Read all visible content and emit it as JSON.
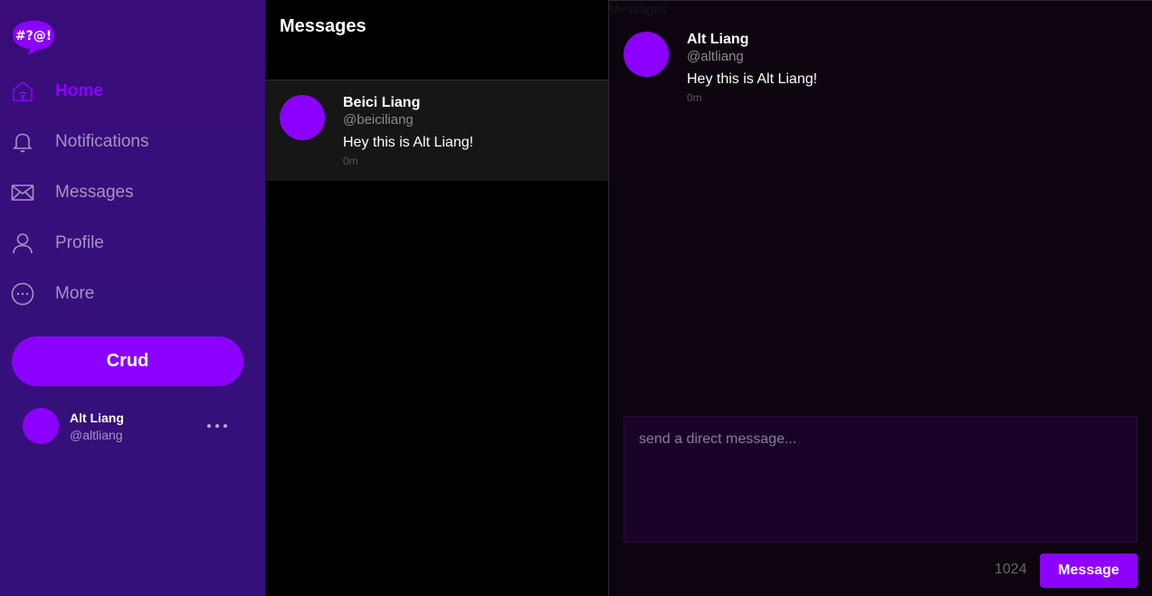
{
  "logo": {
    "text": "#?@!",
    "color": "#8b00ff"
  },
  "nav": [
    {
      "label": "Home",
      "icon": "home-icon",
      "active": true
    },
    {
      "label": "Notifications",
      "icon": "bell-icon",
      "active": false
    },
    {
      "label": "Messages",
      "icon": "mail-icon",
      "active": false
    },
    {
      "label": "Profile",
      "icon": "user-icon",
      "active": false
    },
    {
      "label": "More",
      "icon": "more-circle-icon",
      "active": false
    }
  ],
  "crud_button": "Crud",
  "account": {
    "name": "Alt Liang",
    "handle": "@altliang"
  },
  "messages_list": {
    "title": "Messages",
    "conversations": [
      {
        "name": "Beici Liang",
        "handle": "@beiciliang",
        "text": "Hey this is Alt Liang!",
        "time": "0m"
      }
    ]
  },
  "chat": {
    "caption": "Messages",
    "messages": [
      {
        "name": "Alt Liang",
        "handle": "@altliang",
        "text": "Hey this is Alt Liang!",
        "time": "0m"
      }
    ],
    "composer_placeholder": "send a direct message...",
    "char_count": "1024",
    "send_label": "Message"
  },
  "colors": {
    "accent": "#8b00ff",
    "sidebar": "#3a0c7a"
  }
}
